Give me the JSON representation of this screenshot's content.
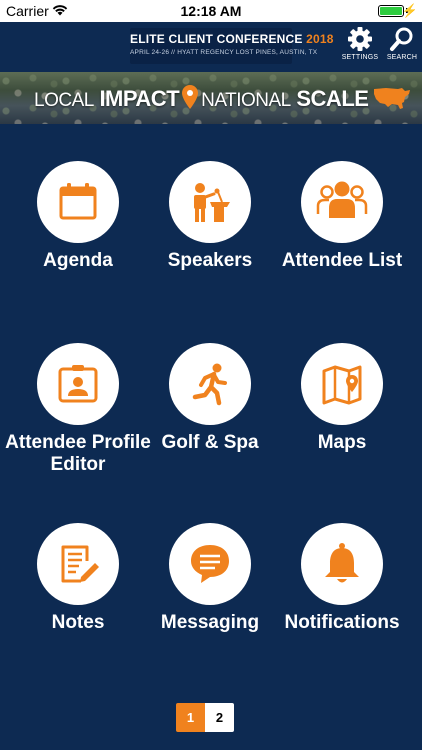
{
  "status_bar": {
    "carrier": "Carrier",
    "time": "12:18 AM"
  },
  "header": {
    "title": "ELITE CLIENT CONFERENCE",
    "year": "2018",
    "subtitle": "APRIL 24-26 // HYATT REGENCY LOST PINES, AUSTIN, TX",
    "settings_label": "SETTINGS",
    "search_label": "SEARCH"
  },
  "banner": {
    "word1": "LOCAL",
    "word2": "IMPACT",
    "word3": "NATIONAL",
    "word4": "SCALE"
  },
  "tiles": [
    {
      "label": "Agenda",
      "icon": "calendar-icon"
    },
    {
      "label": "Speakers",
      "icon": "speaker-podium-icon"
    },
    {
      "label": "Attendee List",
      "icon": "group-icon"
    },
    {
      "label": "Attendee Profile Editor",
      "icon": "id-badge-icon"
    },
    {
      "label": "Golf & Spa",
      "icon": "running-person-icon"
    },
    {
      "label": "Maps",
      "icon": "map-icon"
    },
    {
      "label": "Notes",
      "icon": "note-edit-icon"
    },
    {
      "label": "Messaging",
      "icon": "chat-bubble-icon"
    },
    {
      "label": "Notifications",
      "icon": "bell-icon"
    }
  ],
  "pager": {
    "pages": [
      "1",
      "2"
    ],
    "current": "1"
  },
  "colors": {
    "background": "#0d2a52",
    "accent": "#f0821e",
    "tile": "#ffffff",
    "text": "#ffffff"
  }
}
